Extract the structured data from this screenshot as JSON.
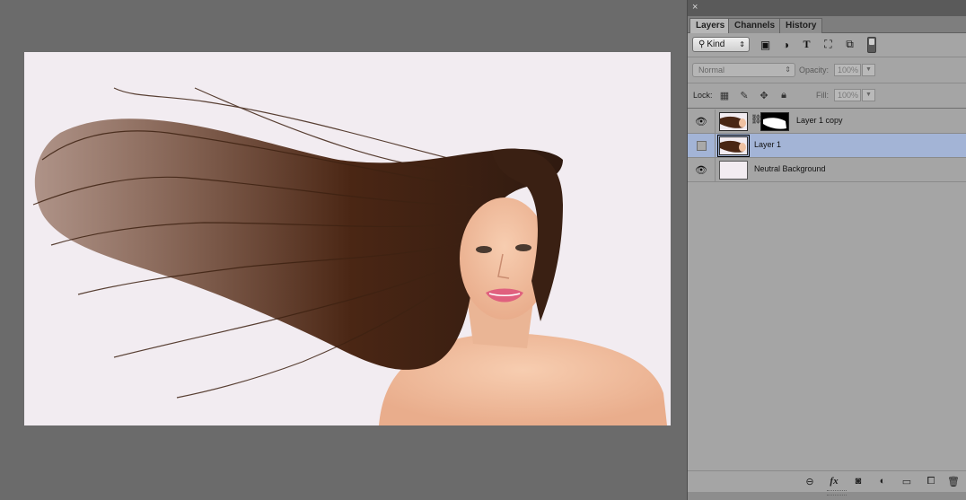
{
  "panel": {
    "close_glyph": "×",
    "tabs": [
      {
        "label": "Layers",
        "active": true
      },
      {
        "label": "Channels",
        "active": false
      },
      {
        "label": "History",
        "active": false
      }
    ],
    "filter": {
      "kind_label": "Kind",
      "icons": [
        "image-filter-icon",
        "adjustment-filter-icon",
        "type-filter-icon",
        "shape-filter-icon",
        "smart-object-filter-icon"
      ]
    },
    "blend": {
      "mode": "Normal",
      "opacity_label": "Opacity:",
      "opacity_value": "100%"
    },
    "lock": {
      "label": "Lock:",
      "fill_label": "Fill:",
      "fill_value": "100%",
      "icons": [
        "lock-transparent-icon",
        "lock-pixels-icon",
        "lock-position-icon",
        "lock-all-icon"
      ]
    },
    "layers": [
      {
        "name": "Layer 1 copy",
        "visible": true,
        "selected": false,
        "has_mask": true
      },
      {
        "name": "Layer 1",
        "visible": false,
        "selected": true,
        "has_mask": false
      },
      {
        "name": "Neutral Background",
        "visible": true,
        "selected": false,
        "has_mask": false
      }
    ],
    "bottom_icons": [
      "link-layers-icon",
      "fx-icon",
      "add-mask-icon",
      "adjustment-layer-icon",
      "new-group-icon",
      "new-layer-icon",
      "delete-layer-icon"
    ]
  },
  "colors": {
    "canvas_bg": "#f2ecf1",
    "workspace_bg": "#6b6b6b",
    "panel_bg": "#a5a5a5",
    "selection": "#a3b4d6",
    "hair": "#4a2a17"
  }
}
